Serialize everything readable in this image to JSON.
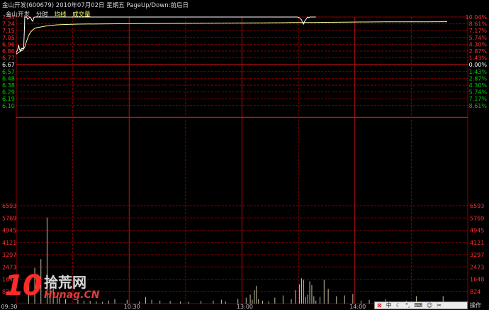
{
  "header": {
    "stock_title": "金山开发(600679) 2010年07月02日 星期五 PageUp/Down:前后日",
    "stock_name": "金山开发",
    "tab_fenshi": "分时",
    "tab_junxian": "均线",
    "tab_volume": "成交量"
  },
  "colors": {
    "background": "#000000",
    "grid": "#8b0000",
    "price_line": "#ffffff",
    "avg_line": "#ffff99",
    "up_text": "#ff3030",
    "down_text": "#00d000",
    "neutral_text": "#ffffff",
    "volume_bar": "#c8c0a0"
  },
  "chart_data": {
    "type": "line",
    "prev_close": 6.67,
    "left_price_ticks": [
      "7.34",
      "7.24",
      "7.15",
      "7.05",
      "6.96",
      "6.86",
      "6.77",
      "6.67",
      "6.57",
      "6.48",
      "6.38",
      "6.29",
      "6.19",
      "6.10"
    ],
    "right_pct_ticks": [
      "10.04%",
      "8.61%",
      "7.17%",
      "5.74%",
      "4.30%",
      "2.87%",
      "1.43%",
      "0.00%",
      "1.43%",
      "2.87%",
      "4.30%",
      "5.74%",
      "7.17%",
      "8.61%"
    ],
    "volume_ticks": [
      "6593",
      "5769",
      "4945",
      "4121",
      "3297",
      "2473",
      "1648",
      "824"
    ],
    "x_ticks": [
      "09:30",
      "10:30",
      "13:00",
      "14:00"
    ],
    "price_ylim": [
      6.0,
      7.34
    ],
    "volume_ylim": [
      0,
      6593
    ],
    "price_series": {
      "name": "分时",
      "t": [
        0,
        3,
        6,
        9,
        10,
        12,
        15,
        18,
        20,
        22,
        25,
        27,
        30,
        33,
        36,
        40,
        41,
        43,
        45,
        47,
        50,
        55,
        60,
        65,
        70,
        75,
        80,
        85,
        90,
        100,
        120,
        150,
        180,
        200,
        210,
        215,
        219,
        220,
        222,
        225,
        230,
        240,
        260,
        300,
        330,
        360,
        390,
        410,
        420,
        430,
        440,
        450,
        460,
        470,
        480,
        490,
        500,
        520,
        540,
        560,
        600,
        615,
        640,
        665,
        670,
        720,
        750,
        800,
        1000,
        1200,
        1350,
        1370,
        1380,
        1390,
        1395,
        1400,
        1405,
        1410,
        1415,
        1420,
        1425,
        1430,
        1440,
        1450,
        1460
      ],
      "v": [
        6.84,
        6.86,
        6.88,
        6.91,
        6.93,
        6.94,
        6.89,
        6.87,
        6.88,
        6.87,
        6.9,
        6.89,
        6.9,
        6.89,
        6.91,
        7.21,
        7.34,
        7.34,
        7.34,
        7.34,
        7.34,
        7.31,
        7.32,
        7.34,
        7.33,
        7.3,
        7.28,
        7.33,
        7.34,
        7.34,
        7.34,
        7.34,
        7.34,
        7.34,
        7.34,
        7.34,
        7.34,
        7.34,
        7.34,
        7.34,
        7.34,
        7.34,
        7.34,
        7.34,
        7.34,
        7.34,
        7.34,
        7.34,
        7.34,
        7.34,
        7.34,
        7.34,
        7.34,
        7.34,
        7.34,
        7.34,
        7.34,
        7.34,
        7.34,
        7.34,
        7.34,
        7.34,
        7.34,
        7.34,
        7.34,
        7.34,
        7.34,
        7.34,
        7.34,
        7.34,
        7.34,
        7.34,
        7.33,
        7.3,
        7.26,
        7.24,
        7.28,
        7.3,
        7.32,
        7.34,
        7.33,
        7.34,
        7.34,
        7.34,
        7.34
      ]
    },
    "avg_series": {
      "name": "均线",
      "t": [
        0,
        10,
        20,
        30,
        40,
        50,
        60,
        70,
        80,
        90,
        100,
        120,
        140,
        160,
        180,
        200,
        240,
        300,
        400,
        600,
        800,
        1000,
        1200,
        1300,
        1350,
        1400,
        1450,
        1500,
        1600,
        1700,
        1800,
        2000,
        2100
      ],
      "v": [
        6.82,
        6.84,
        6.86,
        6.87,
        6.91,
        7.0,
        7.08,
        7.13,
        7.16,
        7.18,
        7.19,
        7.2,
        7.21,
        7.22,
        7.225,
        7.23,
        7.235,
        7.24,
        7.243,
        7.248,
        7.25,
        7.255,
        7.258,
        7.26,
        7.262,
        7.262,
        7.263,
        7.265,
        7.268,
        7.27,
        7.272,
        7.273,
        7.274
      ]
    },
    "volume_series": {
      "name": "成交量",
      "t": [
        60,
        90,
        120,
        150,
        165,
        180,
        200,
        210,
        240,
        300,
        330,
        360,
        390,
        420,
        450,
        480,
        540,
        600,
        630,
        660,
        700,
        750,
        800,
        840,
        900,
        960,
        1000,
        1020,
        1080,
        1120,
        1140,
        1150,
        1160,
        1170,
        1180,
        1200,
        1230,
        1260,
        1300,
        1340,
        1360,
        1380,
        1390,
        1400,
        1410,
        1420,
        1430,
        1440,
        1450,
        1460,
        1480,
        1500,
        1520,
        1560,
        1600,
        1640,
        1680,
        1720,
        1760,
        1800,
        1850,
        1900,
        1950,
        2000,
        2050,
        2080
      ],
      "v": [
        1600,
        2400,
        3000,
        5800,
        1500,
        1700,
        600,
        400,
        300,
        250,
        200,
        180,
        150,
        120,
        200,
        300,
        250,
        150,
        450,
        250,
        200,
        180,
        150,
        120,
        180,
        200,
        260,
        150,
        320,
        400,
        600,
        250,
        900,
        1200,
        300,
        200,
        150,
        400,
        550,
        300,
        900,
        1300,
        1700,
        1600,
        450,
        600,
        1500,
        1250,
        500,
        200,
        450,
        1600,
        1000,
        500,
        550,
        650,
        200,
        250,
        150,
        300,
        120,
        200,
        500,
        150,
        120,
        500
      ]
    }
  },
  "watermark": {
    "num": "10",
    "cn": "拾荒网",
    "url": "Hunag.CN"
  },
  "toolbar": {
    "zhong": "中",
    "op": "操作"
  }
}
